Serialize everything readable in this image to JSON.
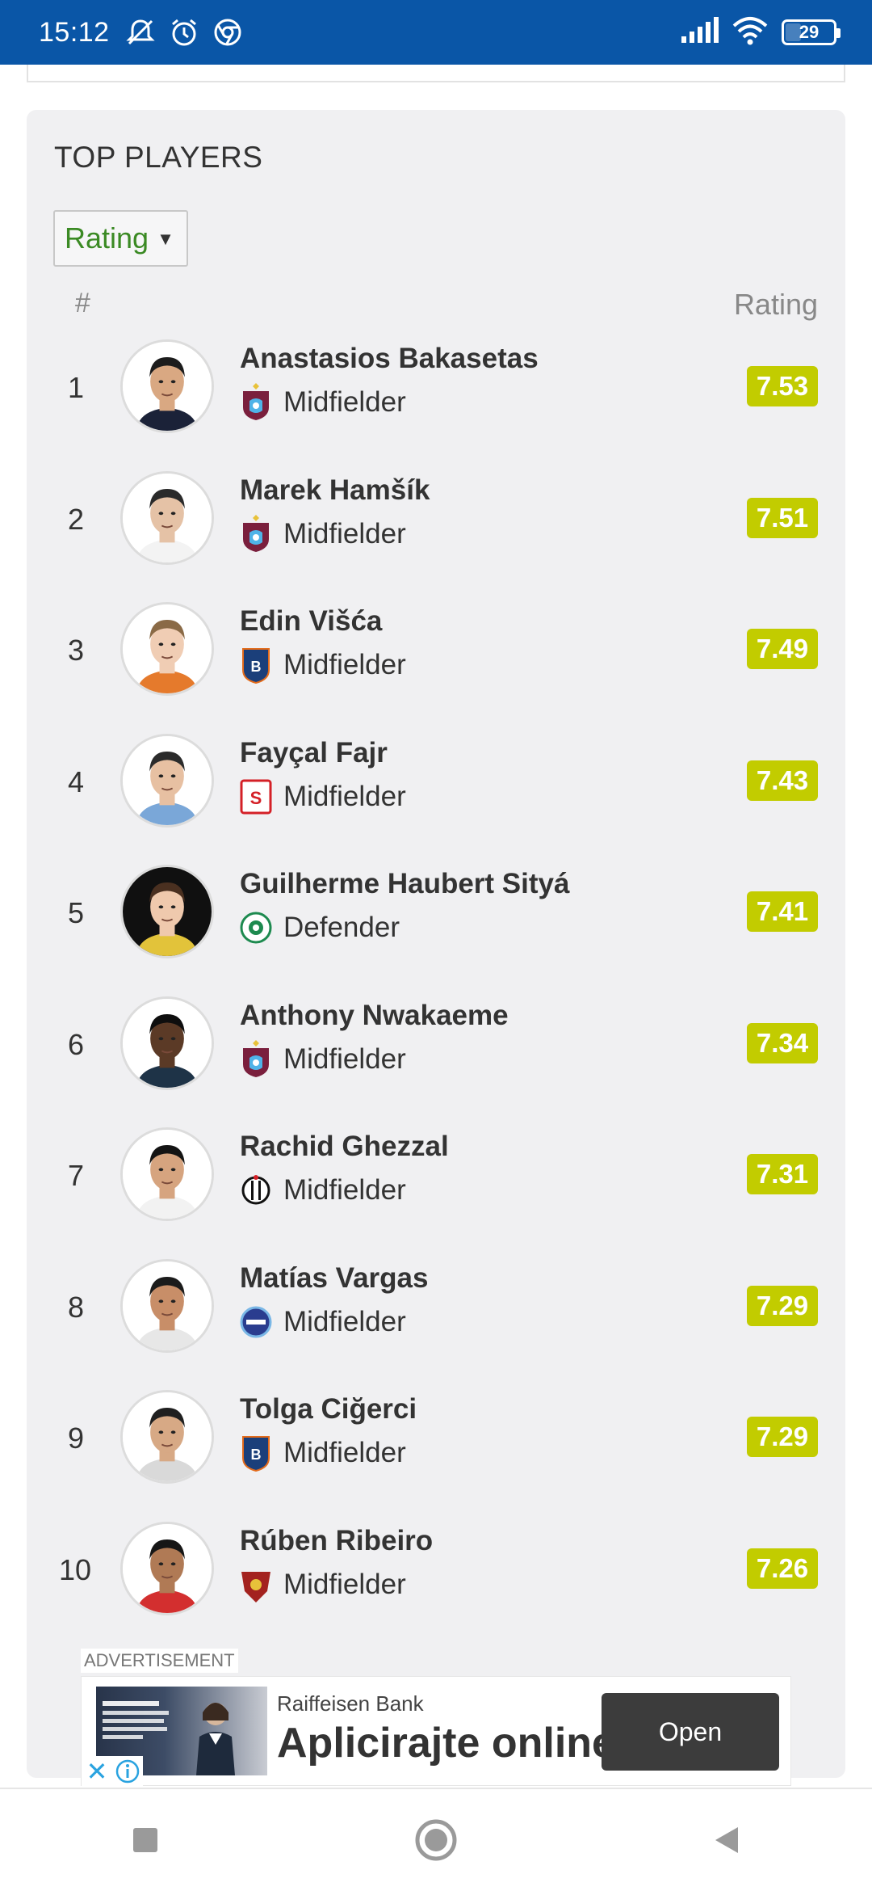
{
  "status_bar": {
    "time": "15:12",
    "battery": "29",
    "icons": [
      "mute-icon",
      "alarm-icon",
      "chrome-icon",
      "signal-icon",
      "wifi-icon",
      "battery-icon"
    ]
  },
  "card": {
    "title": "TOP PLAYERS",
    "selector_value": "Rating",
    "col_rank": "#",
    "col_rating": "Rating"
  },
  "colors": {
    "rating_badge": "#c2cc00",
    "selector_text": "#3b8a24",
    "status_bar": "#0a56a7"
  },
  "players": [
    {
      "rank": "1",
      "name": "Anastasios Bakasetas",
      "position": "Midfielder",
      "club_icon": "trabzonspor-badge-icon",
      "rating": "7.53"
    },
    {
      "rank": "2",
      "name": "Marek Hamšík",
      "position": "Midfielder",
      "club_icon": "trabzonspor-badge-icon",
      "rating": "7.51"
    },
    {
      "rank": "3",
      "name": "Edin Višća",
      "position": "Midfielder",
      "club_icon": "basaksehir-badge-icon",
      "rating": "7.49"
    },
    {
      "rank": "4",
      "name": "Fayçal Fajr",
      "position": "Midfielder",
      "club_icon": "sivasspor-badge-icon",
      "rating": "7.43"
    },
    {
      "rank": "5",
      "name": "Guilherme Haubert Sityá",
      "position": "Defender",
      "club_icon": "konyaspor-badge-icon",
      "rating": "7.41"
    },
    {
      "rank": "6",
      "name": "Anthony Nwakaeme",
      "position": "Midfielder",
      "club_icon": "trabzonspor-badge-icon",
      "rating": "7.34"
    },
    {
      "rank": "7",
      "name": "Rachid Ghezzal",
      "position": "Midfielder",
      "club_icon": "besiktas-badge-icon",
      "rating": "7.31"
    },
    {
      "rank": "8",
      "name": "Matías Vargas",
      "position": "Midfielder",
      "club_icon": "adana-demirspor-badge-icon",
      "rating": "7.29"
    },
    {
      "rank": "9",
      "name": "Tolga Ciğerci",
      "position": "Midfielder",
      "club_icon": "basaksehir-badge-icon",
      "rating": "7.29"
    },
    {
      "rank": "10",
      "name": "Rúben Ribeiro",
      "position": "Midfielder",
      "club_icon": "hatayspor-badge-icon",
      "rating": "7.26"
    }
  ],
  "ad": {
    "label": "ADVERTISEMENT",
    "advertiser": "Raiffeisen Bank",
    "headline": "Aplicirajte online",
    "cta": "Open"
  },
  "navbar": {
    "buttons": [
      "recents-square-icon",
      "home-circle-icon",
      "back-triangle-icon"
    ]
  }
}
